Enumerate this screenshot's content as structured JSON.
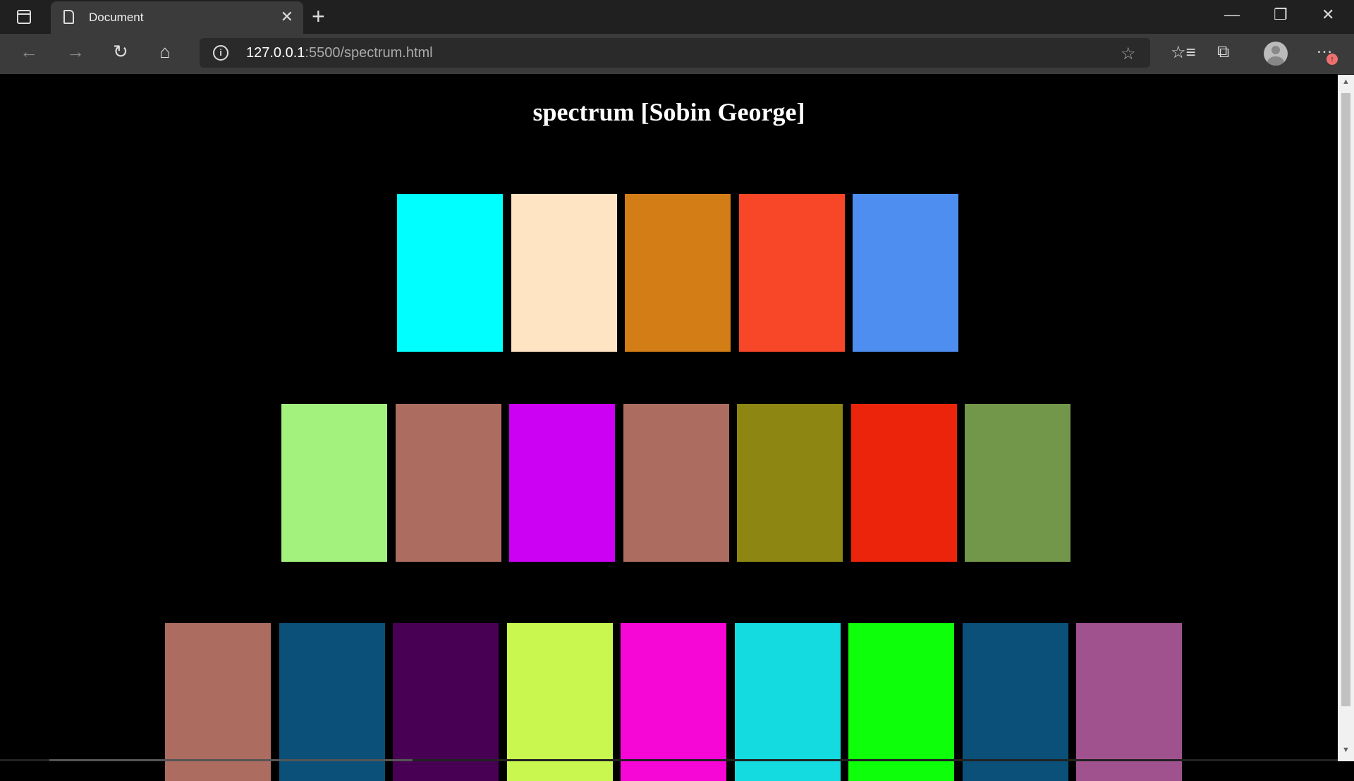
{
  "browser": {
    "tab_title": "Document",
    "url_host": "127.0.0.1",
    "url_rest": ":5500/spectrum.html"
  },
  "page": {
    "title": "spectrum [Sobin George]"
  },
  "rows": [
    [
      "#00ffff",
      "#ffe4c4",
      "#d27d16",
      "#f84728",
      "#4e8ef0"
    ],
    [
      "#a3f27d",
      "#ac6d60",
      "#cc00f2",
      "#ac6d60",
      "#8d8612",
      "#ec240c",
      "#72974a"
    ],
    [
      "#ac6d60",
      "#0a5078",
      "#470054",
      "#c9f74f",
      "#f707d6",
      "#13dbe0",
      "#0dff0a",
      "#0a5078",
      "#a0528f"
    ]
  ]
}
